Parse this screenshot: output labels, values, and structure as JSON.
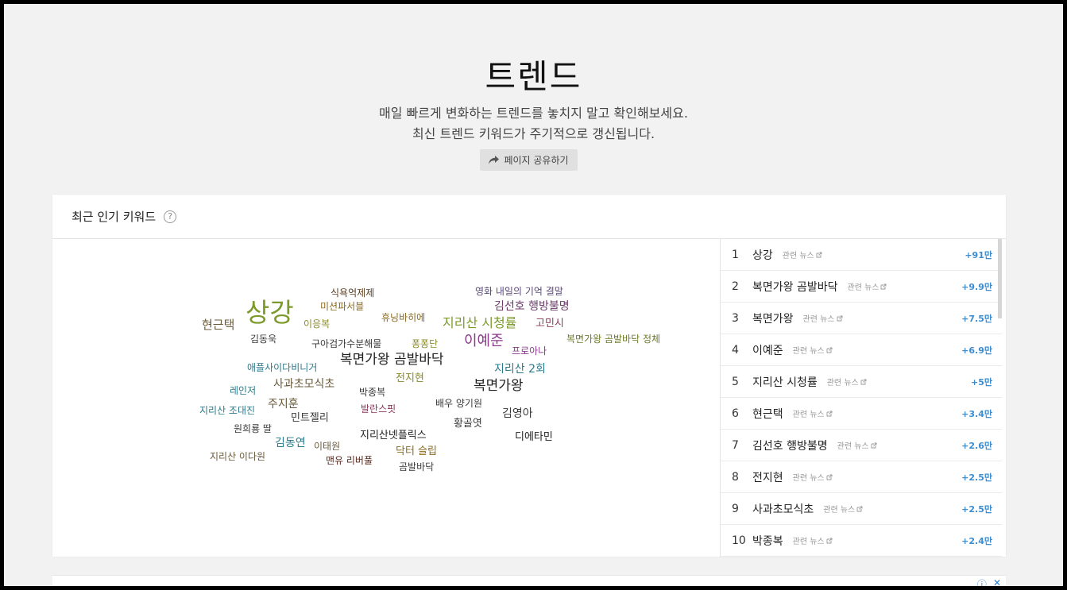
{
  "hero": {
    "title": "트렌드",
    "line1": "매일 빠르게 변화하는 트렌드를 놓치지 말고 확인해보세요.",
    "line2": "최신 트렌드 키워드가 주기적으로 갱신됩니다.",
    "share_label": "페이지 공유하기"
  },
  "section": {
    "title": "최근 인기 키워드",
    "help": "?"
  },
  "cloud": [
    {
      "text": "식욕억제제",
      "color": "#5a3d1e"
    },
    {
      "text": "영화 내일의 기억 결말",
      "color": "#5a4a7a"
    },
    {
      "text": "미션파서블",
      "color": "#8a6a1e"
    },
    {
      "text": "김선호 행방불명",
      "color": "#6b3a6b"
    },
    {
      "text": "상강",
      "color": "#7c9a2a"
    },
    {
      "text": "휴닝바히에",
      "color": "#8a6a1e"
    },
    {
      "text": "지리산 시청률",
      "color": "#7c9a2a"
    },
    {
      "text": "고민시",
      "color": "#8b3a5a"
    },
    {
      "text": "현근택",
      "color": "#6a5a3a"
    },
    {
      "text": "이응복",
      "color": "#8a8a2a"
    },
    {
      "text": "김동욱",
      "color": "#3a3a3a"
    },
    {
      "text": "구아검가수분해물",
      "color": "#3a3a3a"
    },
    {
      "text": "퐁퐁단",
      "color": "#8a8a2a"
    },
    {
      "text": "이예준",
      "color": "#8b3a8b"
    },
    {
      "text": "복면가왕 곰발바닥 정체",
      "color": "#6b7a2a"
    },
    {
      "text": "프로아나",
      "color": "#8b3a8b"
    },
    {
      "text": "복면가왕 곰발바닥",
      "color": "#222222"
    },
    {
      "text": "애플사이다비니거",
      "color": "#2a7a8b"
    },
    {
      "text": "지리산 2회",
      "color": "#2a7a8b"
    },
    {
      "text": "전지현",
      "color": "#8a8a2a"
    },
    {
      "text": "사과초모식초",
      "color": "#6a5a3a"
    },
    {
      "text": "복면가왕",
      "color": "#222222"
    },
    {
      "text": "레인저",
      "color": "#2a7a8b"
    },
    {
      "text": "박종복",
      "color": "#3a3a3a"
    },
    {
      "text": "주지훈",
      "color": "#6a5a3a"
    },
    {
      "text": "배우 양기원",
      "color": "#3a3a3a"
    },
    {
      "text": "지리산 조대진",
      "color": "#2a7a8b"
    },
    {
      "text": "발란스핏",
      "color": "#8b3a5a"
    },
    {
      "text": "김영아",
      "color": "#3a3a3a"
    },
    {
      "text": "민트젤리",
      "color": "#3a3a3a"
    },
    {
      "text": "황골엿",
      "color": "#3a3a3a"
    },
    {
      "text": "원희룡 딸",
      "color": "#3a3a3a"
    },
    {
      "text": "지리산넷플릭스",
      "color": "#222222"
    },
    {
      "text": "디에타민",
      "color": "#222222"
    },
    {
      "text": "김동연",
      "color": "#2a7a8b"
    },
    {
      "text": "이태원",
      "color": "#6a5a3a"
    },
    {
      "text": "닥터 슬립",
      "color": "#8a6a1e"
    },
    {
      "text": "지리산 이다원",
      "color": "#6a5a3a"
    },
    {
      "text": "맨유 리버풀",
      "color": "#5a2a1e"
    },
    {
      "text": "곰발바닥",
      "color": "#3a3a3a"
    }
  ],
  "ranking": [
    {
      "rank": "1",
      "keyword": "상강",
      "news": "관련 뉴스",
      "delta": "+91만"
    },
    {
      "rank": "2",
      "keyword": "복면가왕 곰발바닥",
      "news": "관련 뉴스",
      "delta": "+9.9만"
    },
    {
      "rank": "3",
      "keyword": "복면가왕",
      "news": "관련 뉴스",
      "delta": "+7.5만"
    },
    {
      "rank": "4",
      "keyword": "이예준",
      "news": "관련 뉴스",
      "delta": "+6.9만"
    },
    {
      "rank": "5",
      "keyword": "지리산 시청률",
      "news": "관련 뉴스",
      "delta": "+5만"
    },
    {
      "rank": "6",
      "keyword": "현근택",
      "news": "관련 뉴스",
      "delta": "+3.4만"
    },
    {
      "rank": "7",
      "keyword": "김선호 행방불명",
      "news": "관련 뉴스",
      "delta": "+2.6만"
    },
    {
      "rank": "8",
      "keyword": "전지현",
      "news": "관련 뉴스",
      "delta": "+2.5만"
    },
    {
      "rank": "9",
      "keyword": "사과초모식초",
      "news": "관련 뉴스",
      "delta": "+2.5만"
    },
    {
      "rank": "10",
      "keyword": "박종복",
      "news": "관련 뉴스",
      "delta": "+2.4만"
    }
  ],
  "ad": {
    "info_icon": "ⓘ",
    "close_icon": "✕"
  }
}
